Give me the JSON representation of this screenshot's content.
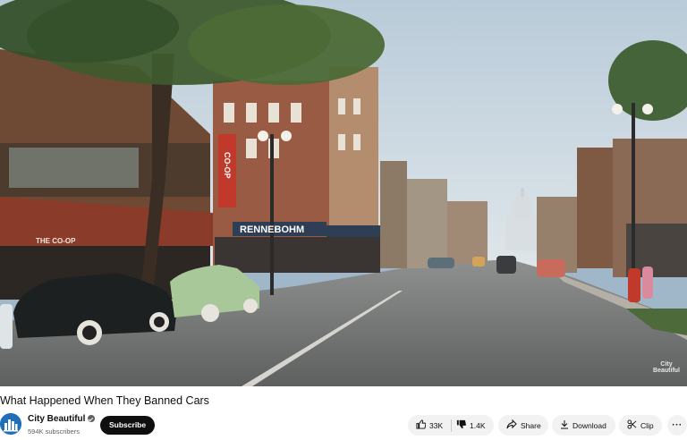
{
  "video": {
    "watermark_line1": "City",
    "watermark_line2": "Beautiful",
    "signs": {
      "coop_vertical": "CO-OP",
      "store_awning": "THE CO-OP",
      "rennebohm": "RENNEBOHM"
    }
  },
  "title": "What Happened When They Banned Cars",
  "channel": {
    "name": "City Beautiful",
    "subscribers": "594K subscribers",
    "subscribe_label": "Subscribe",
    "avatar_icon": "city-skyline-icon",
    "verified_icon": "verified-check-icon"
  },
  "actions": {
    "likes": "33K",
    "dislikes": "1.4K",
    "share_label": "Share",
    "download_label": "Download",
    "clip_label": "Clip",
    "more_label": "···"
  },
  "colors": {
    "subscribe_bg": "#0f0f0f",
    "pill_bg": "#f2f2f2",
    "avatar_bg": "#1f6fb8"
  }
}
